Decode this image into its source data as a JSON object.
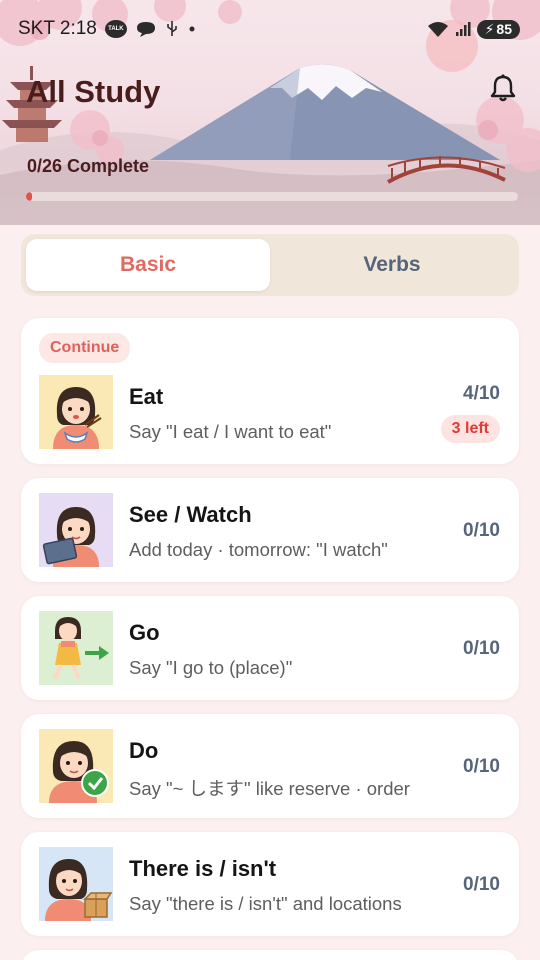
{
  "status_bar": {
    "carrier_time": "SKT 2:18",
    "talk_badge": "TALK",
    "battery": "85",
    "icons": [
      "talk-icon",
      "chat-bubble-icon",
      "usb-icon",
      "dot-icon",
      "wifi-icon",
      "signal-icon",
      "battery-charging-icon"
    ]
  },
  "header": {
    "title": "All Study",
    "progress_label": "0/26 Complete",
    "progress_fraction": 0.012,
    "icon": "bell-icon"
  },
  "tabs": [
    {
      "label": "Basic",
      "active": true
    },
    {
      "label": "Verbs",
      "active": false
    }
  ],
  "lessons": [
    {
      "title": "Eat",
      "subtitle": "Say \"I eat / I want to eat\"",
      "score": "4/10",
      "badge": "3 left",
      "continue_label": "Continue",
      "thumb_bg": "#fbe9b5",
      "thumb_icon": "girl-eating-icon"
    },
    {
      "title": "See / Watch",
      "subtitle": "Add today · tomorrow: \"I watch\"",
      "score": "0/10",
      "thumb_bg": "#e6dcf3",
      "thumb_icon": "girl-tablet-icon"
    },
    {
      "title": "Go",
      "subtitle": "Say \"I go to (place)\"",
      "score": "0/10",
      "thumb_bg": "#dcefd3",
      "thumb_icon": "girl-walking-icon"
    },
    {
      "title": "Do",
      "subtitle": "Say \"~ します\" like reserve · order",
      "score": "0/10",
      "thumb_bg": "#fbe9b5",
      "thumb_icon": "girl-checkmark-icon"
    },
    {
      "title": "There is / isn't",
      "subtitle": "Say \"there is / isn't\" and locations",
      "score": "0/10",
      "thumb_bg": "#d6e6f6",
      "thumb_icon": "girl-box-icon"
    }
  ],
  "colors": {
    "accent": "#e06a61",
    "progress": "#e0524f",
    "badge_red": "#e23a34",
    "score": "#56657c",
    "title_dark": "#4a1d1d"
  }
}
